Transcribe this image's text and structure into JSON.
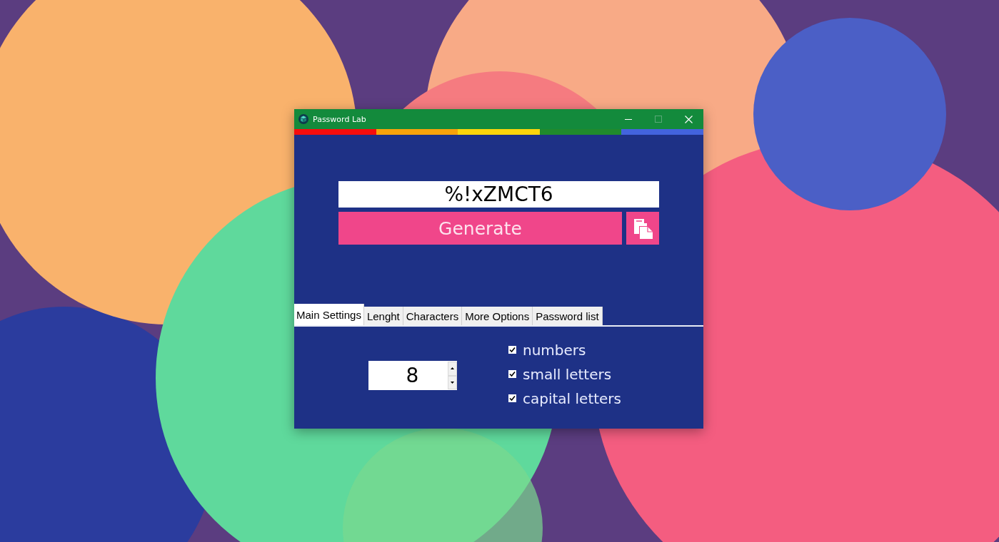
{
  "window": {
    "title": "Password Lab"
  },
  "password": {
    "value": "%!xZMCT6"
  },
  "generate_button": "Generate",
  "tabs": [
    {
      "label": "Main Settings",
      "selected": true
    },
    {
      "label": "Lenght",
      "selected": false
    },
    {
      "label": "Characters",
      "selected": false
    },
    {
      "label": "More Options",
      "selected": false
    },
    {
      "label": "Password list",
      "selected": false
    }
  ],
  "length": {
    "value": "8"
  },
  "options": [
    {
      "label": "numbers",
      "checked": true
    },
    {
      "label": "small letters",
      "checked": true
    },
    {
      "label": "capital letters",
      "checked": true
    }
  ]
}
